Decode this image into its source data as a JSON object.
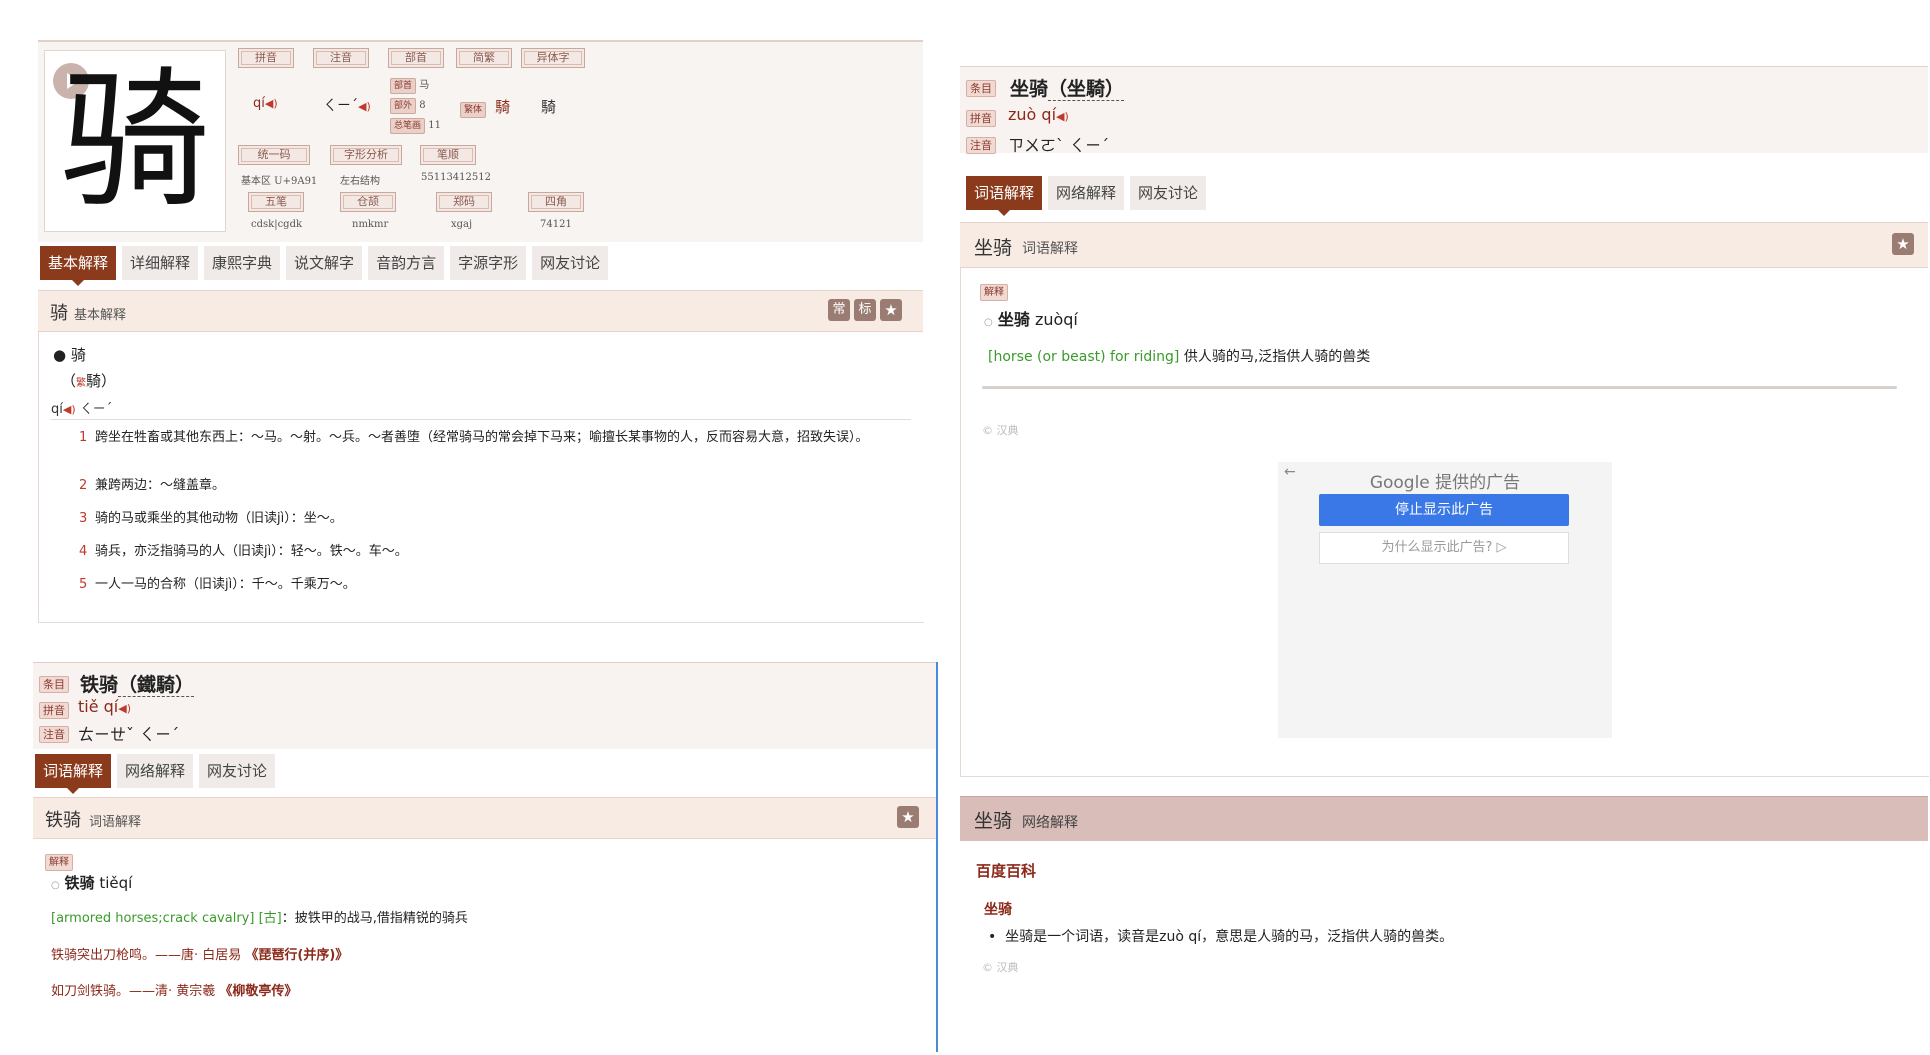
{
  "panel1": {
    "big_char": "骑",
    "headers": [
      "拼音",
      "注音",
      "部首",
      "简繁",
      "异体字",
      "统一码",
      "字形分析",
      "笔顺",
      "五笔",
      "仓颉",
      "郑码",
      "四角"
    ],
    "pinyin": "qí",
    "zhuyin": "ㄑㄧˊ",
    "bushou_label": "部首",
    "bushou_value": "马",
    "buwai_label": "部外",
    "buwai_value": "8",
    "zongbihua_label": "总笔画",
    "zongbihua_value": "11",
    "fanti_label": "繁体",
    "fanti_value": "騎",
    "yiti_value": "騎",
    "unicode_value": "基本区 U+9A91",
    "structure_value": "左右结构",
    "bishun_value": "55113412512",
    "wubi_value": "cdsk|cgdk",
    "cangjie_value": "nmkmr",
    "zhengma_value": "xgaj",
    "sijiao_value": "74121",
    "tabs": [
      "基本解释",
      "详细解释",
      "康熙字典",
      "说文解字",
      "音韵方言",
      "字源字形",
      "网友讨论"
    ],
    "section_char": "骑",
    "section_sub": "基本解释",
    "btn_chang": "常",
    "btn_biao": "标",
    "entry_head": "骑",
    "entry_fanti": "騎",
    "entry_fanti_mark": "繁",
    "entry_pinyin": "qí",
    "entry_zhuyin": "ㄑㄧˊ",
    "defs": [
      {
        "num": "1",
        "text": "跨坐在牲畜或其他东西上：～马。～射。～兵。～者善堕（经常骑马的常会掉下马来；喻擅长某事物的人，反而容易大意，招致失误）。"
      },
      {
        "num": "2",
        "text": "兼跨两边：～缝盖章。"
      },
      {
        "num": "3",
        "text": "骑的马或乘坐的其他动物（旧读jì）：坐～。"
      },
      {
        "num": "4",
        "text": "骑兵，亦泛指骑马的人（旧读jì）：轻～。铁～。车～。"
      },
      {
        "num": "5",
        "text": "一人一马的合称（旧读jì）：千～。千乘万～。"
      }
    ]
  },
  "panel2": {
    "tiaomu_label": "条目",
    "word": "铁骑",
    "word_fanti": "（鐵騎）",
    "pinyin_label": "拼音",
    "pinyin": "tiě qí",
    "zhuyin_label": "注音",
    "zhuyin": "ㄊㄧㄝˇ ㄑㄧˊ",
    "tabs": [
      "词语解释",
      "网络解释",
      "网友讨论"
    ],
    "section_word": "铁骑",
    "section_sub": "词语解释",
    "jieshi_label": "解释",
    "entry_word": "铁骑",
    "entry_pinyin": "tiěqí",
    "english": "[armored horses;crack cavalry]",
    "gu": "[古]",
    "meaning": "：披铁甲的战马,借指精锐的骑兵",
    "quote1_text": "铁骑突出刀枪鸣。——唐· 白居易",
    "quote1_src": "《琵琶行(并序)》",
    "quote2_text": "如刀剑铁骑。——清· 黄宗羲",
    "quote2_src": "《柳敬亭传》"
  },
  "panel3": {
    "tiaomu_label": "条目",
    "word": "坐骑",
    "word_fanti": "（坐騎）",
    "pinyin_label": "拼音",
    "pinyin": "zuò qí",
    "zhuyin_label": "注音",
    "zhuyin": "ㄗㄨㄛˋ ㄑㄧˊ",
    "tabs": [
      "词语解释",
      "网络解释",
      "网友讨论"
    ],
    "section_word": "坐骑",
    "section_sub": "词语解释",
    "jieshi_label": "解释",
    "entry_word": "坐骑",
    "entry_pinyin": "zuòqí",
    "english": "[horse (or beast) for riding]",
    "meaning": "供人骑的马,泛指供人骑的兽类",
    "copyright": "© 汉典",
    "ad_title": "Google 提供的广告",
    "ad_stop": "停止显示此广告",
    "ad_why": "为什么显示此广告?",
    "net_word": "坐骑",
    "net_sub": "网络解释",
    "baike": "百度百科",
    "net_entry": "坐骑",
    "net_bullet": "坐骑是一个词语，读音是zuò qí，意思是人骑的马，泛指供人骑的兽类。",
    "copyright2": "© 汉典"
  }
}
